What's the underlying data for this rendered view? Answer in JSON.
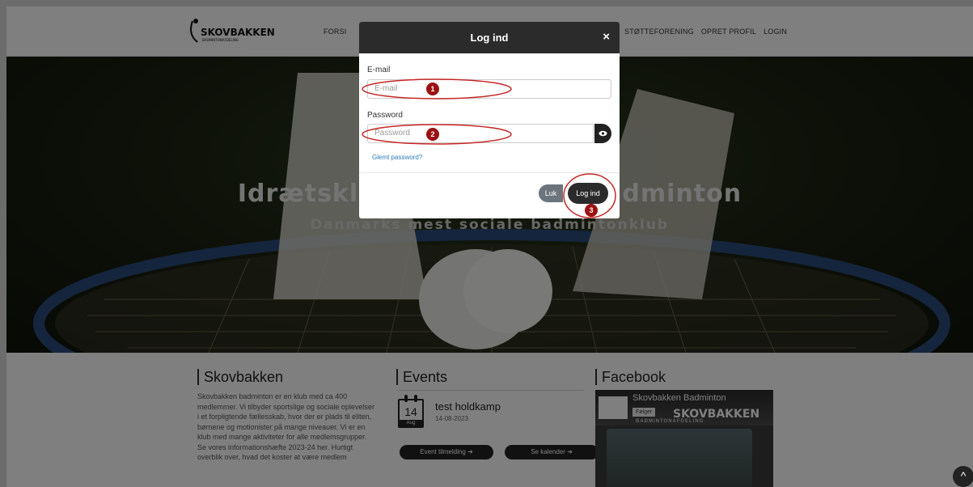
{
  "nav": {
    "left_label": "FORSI",
    "items": [
      "STØTTEFORENING",
      "OPRET PROFIL",
      "LOGIN"
    ]
  },
  "logo": {
    "text": "SKOVBAKKEN",
    "subtext": "BADMINTONAFDELING"
  },
  "hero": {
    "title": "Idrætsklub Skovbakken Badminton",
    "subtitle": "Danmarks mest sociale badmintonklub"
  },
  "about": {
    "heading": "Skovbakken",
    "text": "Skovbakken badminton er en klub med ca 400 medlemmer. Vi tilbyder sportslige og sociale oplevelser i et forpligtende fællesskab, hvor der er plads til eliten, børnene og motionister på mange niveauer. Vi er en klub med mange aktiviteter for alle medlemsgrupper. Se vores informationshæfte 2023-24 her. Hurtigt overblik over, hvad det koster at være medlem"
  },
  "events": {
    "heading": "Events",
    "items": [
      {
        "day": "14",
        "month": "Aug",
        "title": "test holdkamp",
        "date": "14-08-2023"
      }
    ],
    "signup_label": "Event tilmelding ➔",
    "calendar_label": "Se kalender ➔"
  },
  "facebook": {
    "heading": "Facebook",
    "page_name": "Skovbakken Badminton",
    "follow_label": "Følger",
    "banner_text": "SKOVBAKKEN",
    "banner_sub": "BADMINTONAFDELING"
  },
  "modal": {
    "title": "Log ind",
    "close": "×",
    "email_label": "E-mail",
    "email_placeholder": "E-mail",
    "password_label": "Password",
    "password_placeholder": "Password",
    "forgot": "Glemt password?",
    "close_button": "Luk",
    "login_button": "Log ind"
  },
  "annotations": {
    "b1": "1",
    "b2": "2",
    "b3": "3",
    "accent": "#9b1111"
  },
  "scroll_top": "^"
}
